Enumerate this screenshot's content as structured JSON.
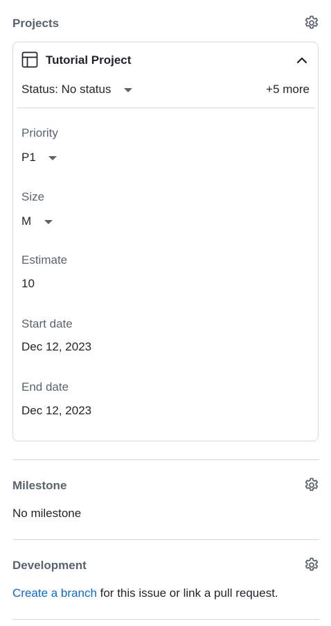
{
  "projects": {
    "title": "Projects",
    "settings_icon": "gear-icon",
    "card": {
      "project_icon": "table-icon",
      "project_name": "Tutorial Project",
      "collapse_icon": "chevron-up-icon",
      "status": "Status: No status",
      "more": "+5 more",
      "fields": [
        {
          "label": "Priority",
          "value": "P1",
          "dropdown": true
        },
        {
          "label": "Size",
          "value": "M",
          "dropdown": true
        },
        {
          "label": "Estimate",
          "value": "10",
          "dropdown": false
        },
        {
          "label": "Start date",
          "value": "Dec 12, 2023",
          "dropdown": false
        },
        {
          "label": "End date",
          "value": "Dec 12, 2023",
          "dropdown": false
        }
      ]
    }
  },
  "milestone": {
    "title": "Milestone",
    "value": "No milestone"
  },
  "development": {
    "title": "Development",
    "link_text": "Create a branch",
    "rest_text": " for this issue or link a pull request."
  },
  "colors": {
    "muted": "#59636e",
    "text": "#1f2328",
    "link": "#0969da",
    "border": "#d1d9e0"
  }
}
